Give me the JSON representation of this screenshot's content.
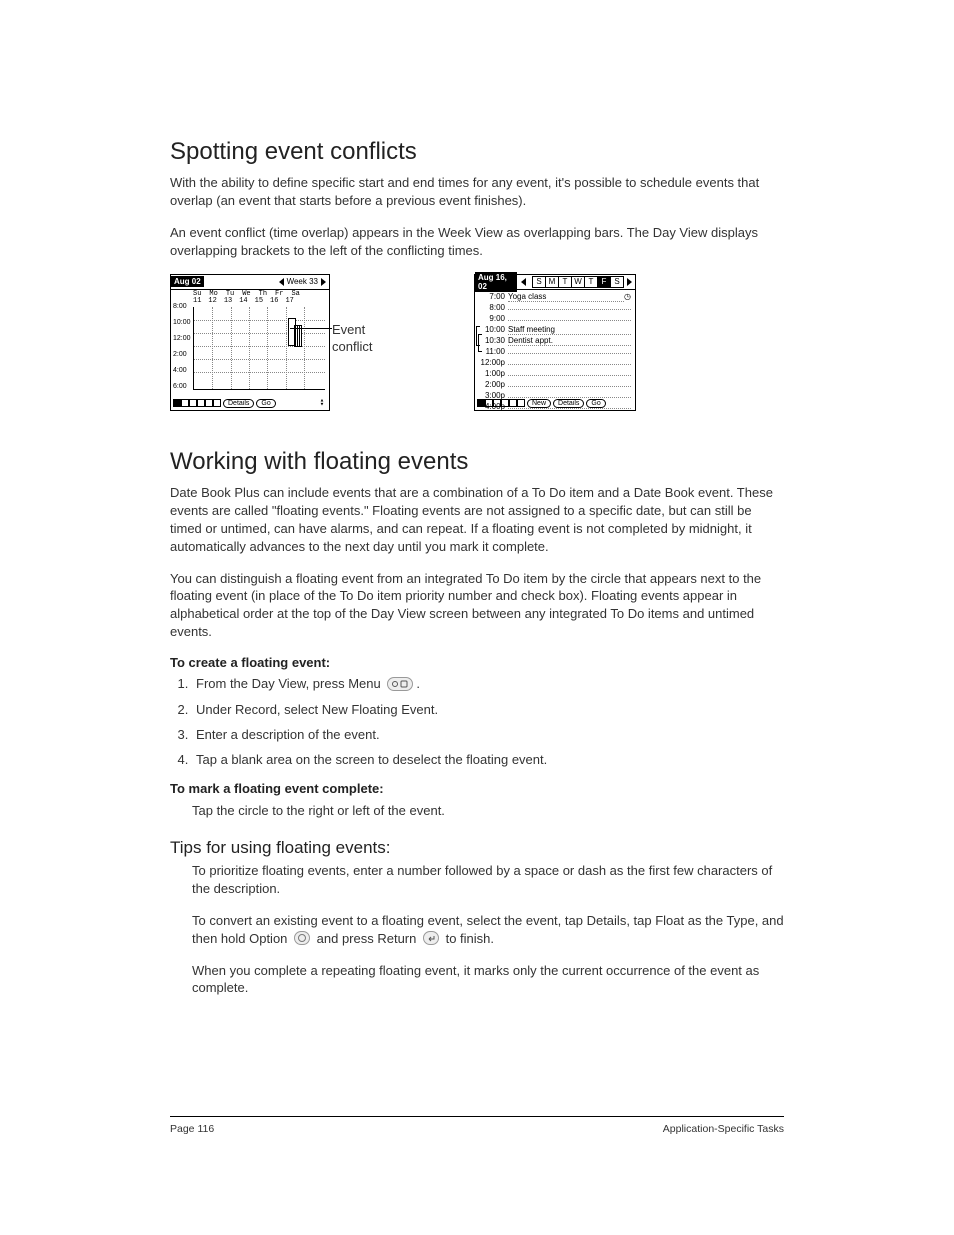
{
  "headings": {
    "h1a": "Spotting event conflicts",
    "h1b": "Working with floating events",
    "h2_tips": "Tips for using floating events:"
  },
  "paragraphs": {
    "conflict1": "With the ability to define specific start and end times for any event, it's possible to schedule events that overlap (an event that starts before a previous event finishes).",
    "conflict2": "An event conflict (time overlap) appears in the Week View as overlapping bars. The Day View displays overlapping brackets to the left of the conflicting times.",
    "floating1": "Date Book Plus can include events that are a combination of a To Do item and a Date Book event. These events are called \"floating events.\" Floating events are not assigned to a specific date, but can still be timed or untimed, can have alarms, and can repeat. If a floating event is not completed by midnight, it automatically advances to the next day until you mark it complete.",
    "floating2": "You can distinguish a floating event from an integrated To Do item by the circle that appears next to the floating event (in place of the To Do item priority number and check box). Floating events appear in alphabetical order at the top of the Day View screen between any integrated To Do items and untimed events.",
    "tips1": "To prioritize floating events, enter a number followed by a space or dash as the first few characters of the description.",
    "tips2a": "To convert an existing event to a floating event, select the event, tap Details, tap Float as the Type, and then hold Option ",
    "tips2b": " and press Return ",
    "tips2c": " to finish.",
    "tips3": "When you complete a repeating floating event, it marks only the current occurrence of the event as complete."
  },
  "procedures": {
    "create_title": "To create a floating event:",
    "create_steps": [
      "From the Day View, press Menu ",
      "Under Record, select New Floating Event.",
      " Enter a description of the event.",
      "Tap a blank area on the screen to deselect the floating event."
    ],
    "mark_title": "To mark a floating event complete:",
    "mark_body": "Tap the circle to the right or left of the event."
  },
  "callout": {
    "line1": "Event",
    "line2": "conflict"
  },
  "week_view": {
    "month": "Aug 02",
    "week_label": "Week 33",
    "day_labels": [
      "Su",
      "Mo",
      "Tu",
      "We",
      "Th",
      "Fr",
      "Sa"
    ],
    "day_numbers": [
      "11",
      "12",
      "13",
      "14",
      "15",
      "16",
      "17"
    ],
    "time_labels": [
      "8:00",
      "10:00",
      "12:00",
      "2:00",
      "4:00",
      "6:00"
    ],
    "buttons": {
      "details": "Details",
      "go": "Go"
    }
  },
  "day_view": {
    "date": "Aug 16, 02",
    "dow_labels": [
      "S",
      "M",
      "T",
      "W",
      "T",
      "F",
      "S"
    ],
    "selected_dow_index": 5,
    "rows": [
      {
        "time": "7:00",
        "text": "Yoga class"
      },
      {
        "time": "8:00",
        "text": ""
      },
      {
        "time": "9:00",
        "text": ""
      },
      {
        "time": "10:00",
        "text": "Staff meeting"
      },
      {
        "time": "10:30",
        "text": "Dentist appt."
      },
      {
        "time": "11:00",
        "text": ""
      },
      {
        "time": "12:00p",
        "text": ""
      },
      {
        "time": "1:00p",
        "text": ""
      },
      {
        "time": "2:00p",
        "text": ""
      },
      {
        "time": "3:00p",
        "text": ""
      },
      {
        "time": "4:00p",
        "text": ""
      }
    ],
    "buttons": {
      "new": "New",
      "details": "Details",
      "go": "Go"
    }
  },
  "footer": {
    "left": "Page 116",
    "right": "Application-Specific Tasks"
  }
}
